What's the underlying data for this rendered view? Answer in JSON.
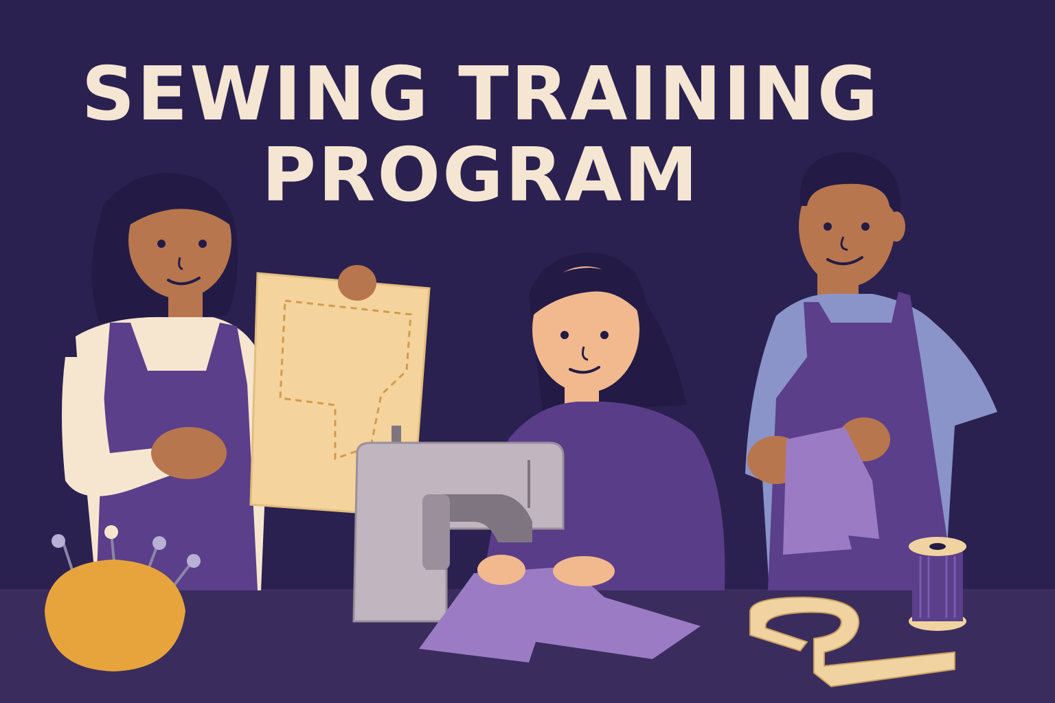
{
  "poster": {
    "title_line_1": "SEWING TRAINING",
    "title_line_2": "PROGRAM"
  },
  "colors": {
    "background": "#2a2150",
    "table": "#3a2d5e",
    "title_text": "#f5e6d3",
    "apron": "#5b3f8a",
    "sweater": "#5a3d88",
    "fabric": "#9b7cc4",
    "skin_dark": "#b8764f",
    "skin_light": "#f2b98f",
    "hair": "#231b45",
    "pattern_paper": "#f4d49c",
    "machine": "#c1b6c0",
    "pincushion": "#e8a43c",
    "shirt_blue": "#8a94c9",
    "sleeve_cream": "#f6e6d0",
    "tape": "#f0d3a0"
  },
  "scene": {
    "figures": [
      "woman-holding-pattern",
      "woman-at-sewing-machine",
      "man-holding-fabric"
    ],
    "objects": [
      "pattern-paper",
      "sewing-machine",
      "pincushion",
      "thread-spool",
      "measuring-tape",
      "fabric"
    ]
  }
}
